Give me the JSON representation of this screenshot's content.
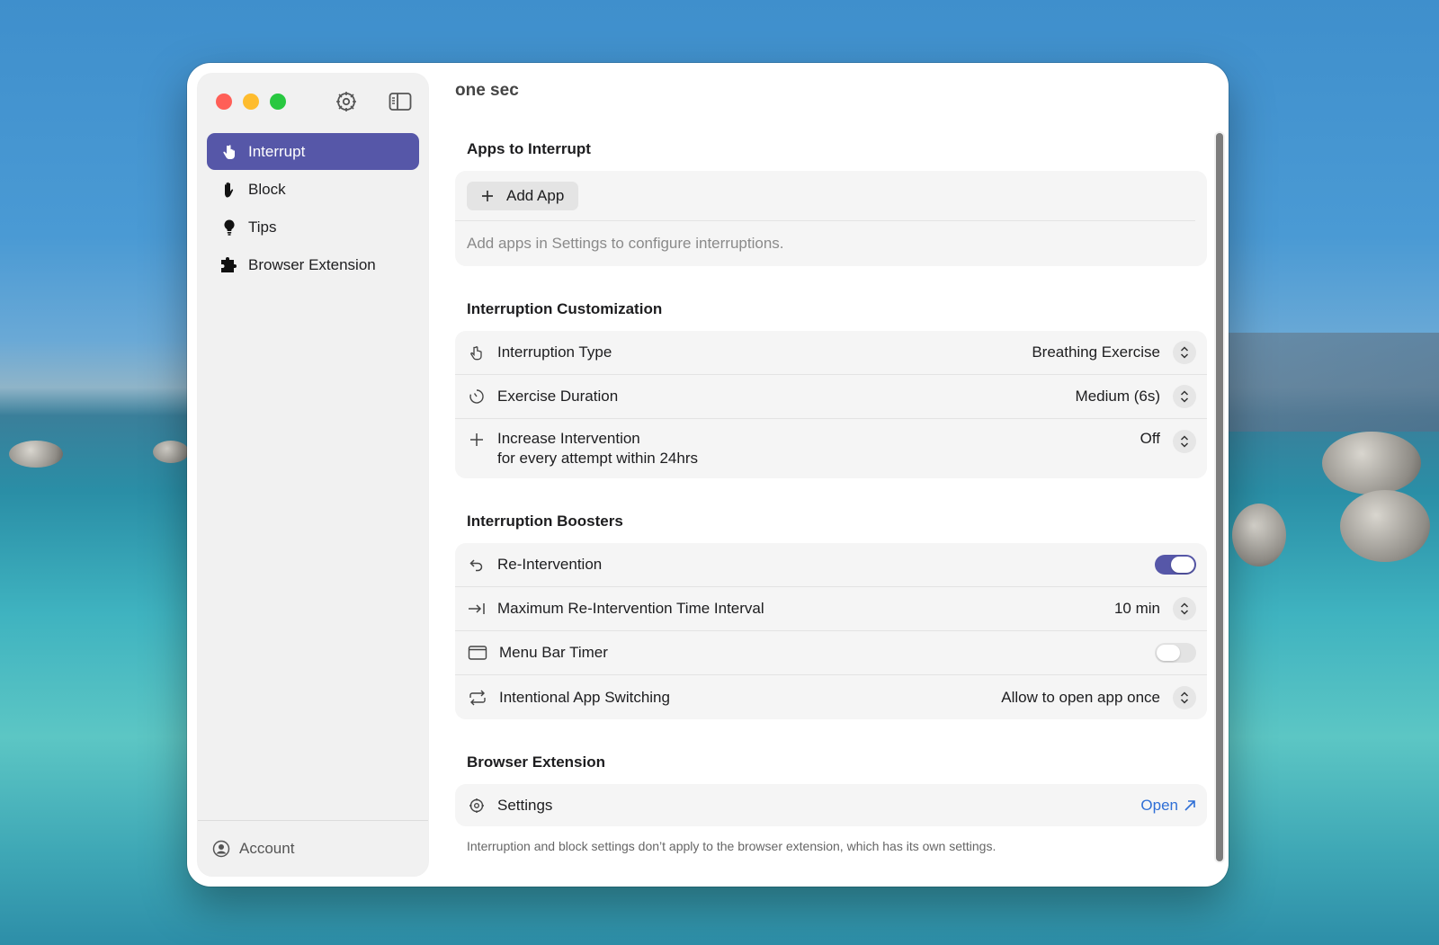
{
  "window": {
    "title": "one sec"
  },
  "sidebar": {
    "items": [
      {
        "label": "Interrupt",
        "icon": "hand-pointer-icon",
        "active": true
      },
      {
        "label": "Block",
        "icon": "hand-raised-icon",
        "active": false
      },
      {
        "label": "Tips",
        "icon": "lightbulb-icon",
        "active": false
      },
      {
        "label": "Browser Extension",
        "icon": "puzzle-piece-icon",
        "active": false
      }
    ],
    "account_label": "Account"
  },
  "sections": {
    "apps": {
      "heading": "Apps to Interrupt",
      "add_button": "Add App",
      "hint": "Add apps in Settings to configure interruptions."
    },
    "customization": {
      "heading": "Interruption Customization",
      "interruption_type": {
        "label": "Interruption Type",
        "value": "Breathing Exercise"
      },
      "exercise_duration": {
        "label": "Exercise Duration",
        "value": "Medium (6s)"
      },
      "increase_intervention": {
        "label": "Increase Intervention",
        "sublabel": "for every attempt within 24hrs",
        "value": "Off"
      }
    },
    "boosters": {
      "heading": "Interruption Boosters",
      "re_intervention": {
        "label": "Re-Intervention",
        "enabled": true
      },
      "max_interval": {
        "label": "Maximum Re-Intervention Time Interval",
        "value": "10 min"
      },
      "menu_bar_timer": {
        "label": "Menu Bar Timer",
        "enabled": false
      },
      "intentional_switching": {
        "label": "Intentional App Switching",
        "value": "Allow to open app once"
      }
    },
    "browser_extension": {
      "heading": "Browser Extension",
      "settings": {
        "label": "Settings",
        "link": "Open"
      },
      "note": "Interruption and block settings don’t apply to the browser extension, which has its own settings."
    }
  },
  "colors": {
    "accent": "#5657a8",
    "link": "#2f6fd6"
  }
}
